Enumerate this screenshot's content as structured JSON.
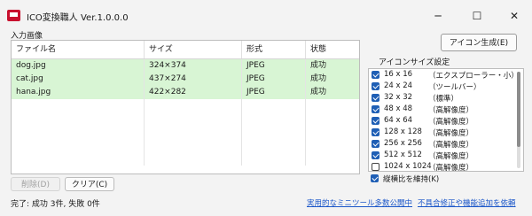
{
  "window": {
    "title": "ICO変換職人 Ver.1.0.0.0",
    "minimize": "─",
    "maximize": "☐",
    "close": "✕"
  },
  "input_group": {
    "label": "入力画像",
    "columns": [
      "ファイル名",
      "サイズ",
      "形式",
      "状態"
    ],
    "rows": [
      {
        "name": "dog.jpg",
        "size": "324×374",
        "format": "JPEG",
        "status": "成功"
      },
      {
        "name": "cat.jpg",
        "size": "437×274",
        "format": "JPEG",
        "status": "成功"
      },
      {
        "name": "hana.jpg",
        "size": "422×282",
        "format": "JPEG",
        "status": "成功"
      }
    ],
    "delete_label": "削除(D)",
    "clear_label": "クリア(C)"
  },
  "generate_label": "アイコン生成(E)",
  "settings": {
    "label": "アイコンサイズ設定",
    "items": [
      {
        "size": "16 x 16",
        "desc": "（エクスプローラー・小）",
        "checked": true
      },
      {
        "size": "24 x 24",
        "desc": "（ツールバー）",
        "checked": true
      },
      {
        "size": "32 x 32",
        "desc": "（標準）",
        "checked": true
      },
      {
        "size": "48 x 48",
        "desc": "（高解像度）",
        "checked": true
      },
      {
        "size": "64 x 64",
        "desc": "（高解像度）",
        "checked": true
      },
      {
        "size": "128 x 128",
        "desc": "（高解像度）",
        "checked": true
      },
      {
        "size": "256 x 256",
        "desc": "（高解像度）",
        "checked": true
      },
      {
        "size": "512 x 512",
        "desc": "（高解像度）",
        "checked": true
      },
      {
        "size": "1024 x 1024",
        "desc": "（高解像度）",
        "checked": false
      }
    ],
    "keep_aspect_label": "縦横比を維持(K)",
    "keep_aspect_checked": true
  },
  "status": {
    "text": "完了: 成功 3件, 失敗 0件",
    "link1": "実用的なミニツール多数公開中",
    "link2": "不具合修正や機能追加を依頼"
  },
  "colors": {
    "success_row": "#d8f5d4",
    "checkbox_accent": "#1f5fb5",
    "link": "#1a56c9",
    "app_icon": "#c8102e"
  }
}
